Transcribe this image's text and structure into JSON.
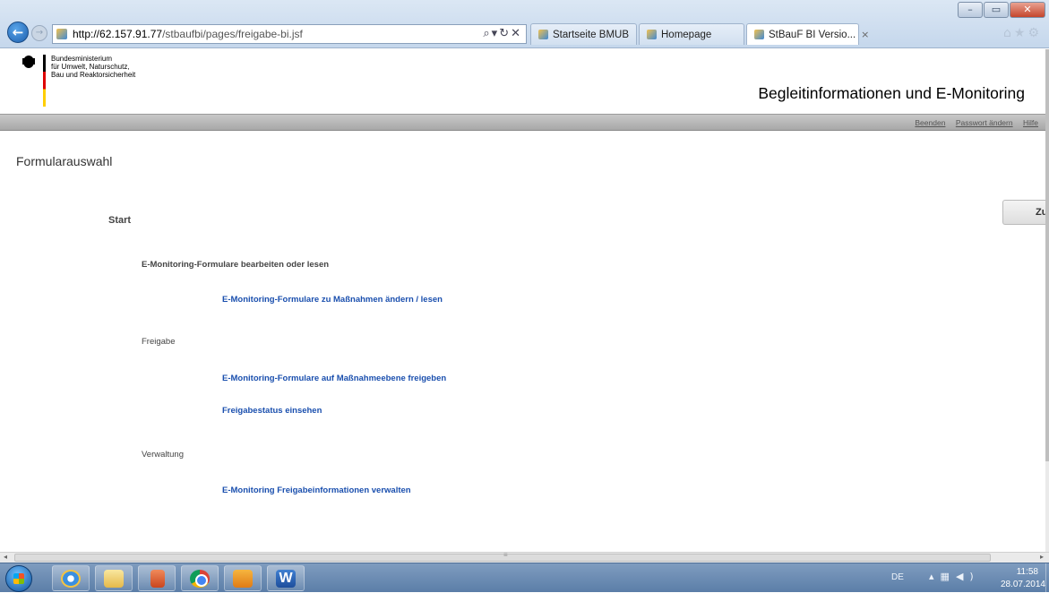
{
  "browser": {
    "url_host": "http://62.157.91.77",
    "url_path": "/stbaufbi/pages/freigabe-bi.jsf",
    "tabs": [
      {
        "label": "Startseite BMUB"
      },
      {
        "label": "Homepage"
      },
      {
        "label": "StBauF BI Versio...",
        "close": "×"
      }
    ],
    "window_controls": {
      "minimize": "–",
      "maximize": "▭",
      "close": "✕"
    }
  },
  "header": {
    "ministry_lines": [
      "Bundesministerium",
      "für Umwelt, Naturschutz,",
      "Bau und Reaktorsicherheit"
    ],
    "app_title": "Begleitinformationen und E-Monitoring",
    "links": {
      "logout": "Beenden",
      "change_password": "Passwort ändern",
      "help": "Hilfe"
    }
  },
  "main": {
    "title": "Formularauswahl",
    "back_button": "Zurück",
    "start": "Start",
    "sections": [
      {
        "heading": "E-Monitoring-Formulare bearbeiten oder lesen",
        "links": [
          "E-Monitoring-Formulare zu Maßnahmen ändern / lesen"
        ]
      },
      {
        "heading": "Freigabe",
        "links": [
          "E-Monitoring-Formulare auf Maßnahmeebene freigeben",
          "Freigabestatus einsehen"
        ]
      },
      {
        "heading": "Verwaltung",
        "links": [
          "E-Monitoring Freigabeinformationen verwalten"
        ]
      }
    ]
  },
  "taskbar": {
    "language": "DE",
    "time": "11:58",
    "date": "28.07.2014",
    "word_letter": "W"
  }
}
